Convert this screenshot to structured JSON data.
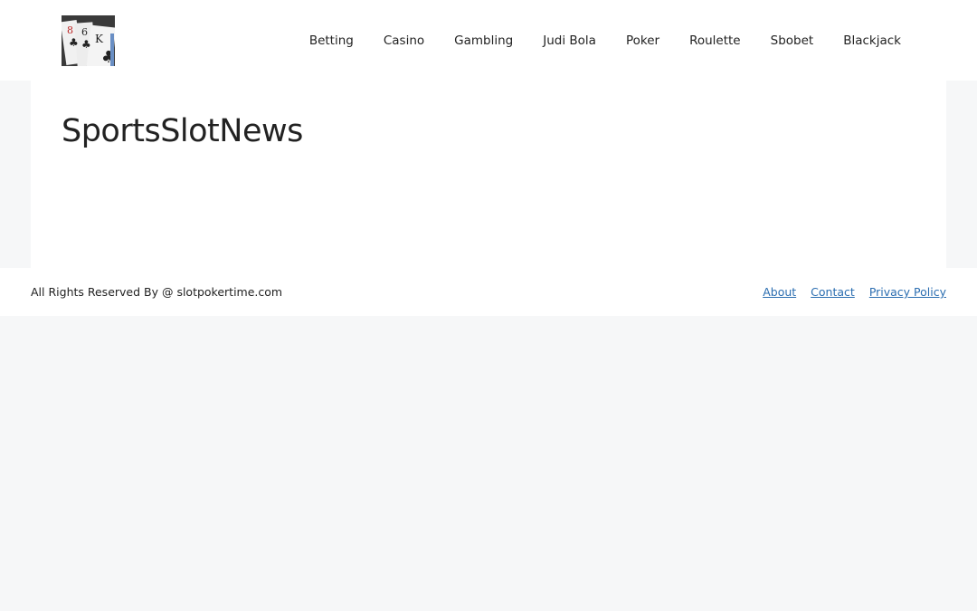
{
  "header": {
    "logo_icon": "playing-cards-logo",
    "nav": [
      {
        "label": "Betting"
      },
      {
        "label": "Casino"
      },
      {
        "label": "Gambling"
      },
      {
        "label": "Judi Bola"
      },
      {
        "label": "Poker"
      },
      {
        "label": "Roulette"
      },
      {
        "label": "Sbobet"
      },
      {
        "label": "Blackjack"
      }
    ]
  },
  "main": {
    "title": "SportsSlotNews"
  },
  "footer": {
    "copyright": "All Rights Reserved By @ slotpokertime.com",
    "links": [
      {
        "label": "About"
      },
      {
        "label": "Contact"
      },
      {
        "label": "Privacy Policy"
      }
    ],
    "link_color": "#2a6db0"
  }
}
